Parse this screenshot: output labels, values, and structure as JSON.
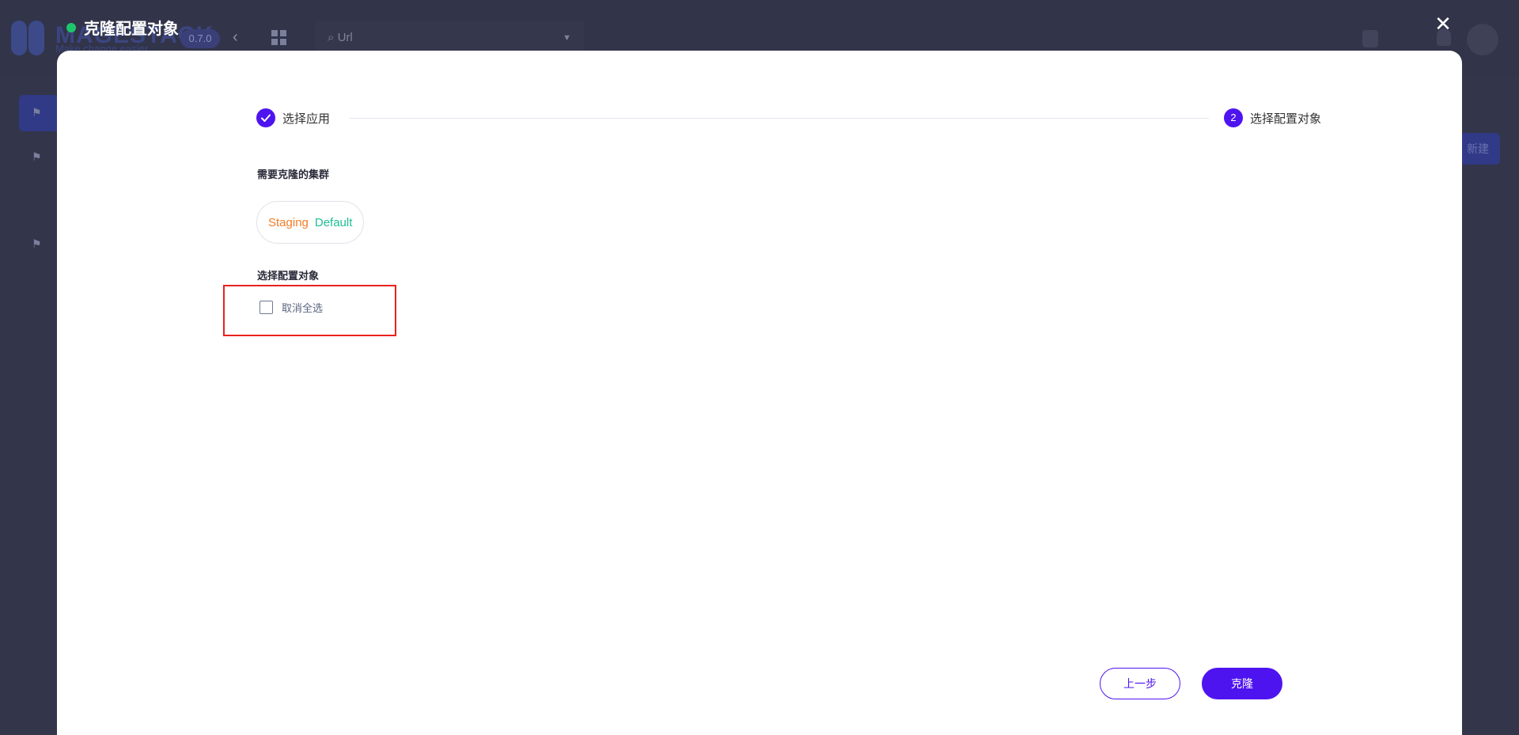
{
  "background_app": {
    "brand": "MAGESTACK",
    "slogan": "Make change easier",
    "version": "0.7.0",
    "search_placeholder": "Url",
    "new_button": "新建"
  },
  "modal": {
    "title": "克隆配置对象",
    "status_color": "#1ec66b",
    "close_icon": "close-icon"
  },
  "stepper": {
    "steps": [
      {
        "label": "选择应用",
        "state": "done",
        "icon": "check-icon"
      },
      {
        "label": "选择配置对象",
        "state": "active",
        "number": "2"
      }
    ]
  },
  "clusters_section": {
    "label": "需要克隆的集群",
    "cluster": {
      "env": "Staging",
      "name": "Default",
      "env_color": "#f07d28",
      "name_color": "#1fc096"
    }
  },
  "objects_section": {
    "label": "选择配置对象",
    "select_all_label": "取消全选",
    "select_all_checked": false
  },
  "footer": {
    "prev_label": "上一步",
    "clone_label": "克隆",
    "accent": "#4e14f0"
  }
}
